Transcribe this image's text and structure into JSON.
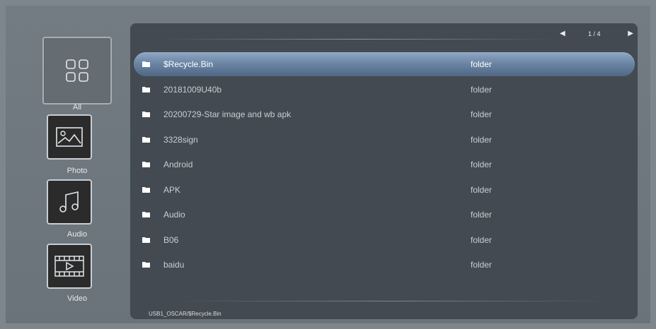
{
  "sidebar": {
    "items": [
      {
        "label": "All",
        "icon": "grid-icon"
      },
      {
        "label": "Photo",
        "icon": "photo-icon"
      },
      {
        "label": "Audio",
        "icon": "music-note-icon"
      },
      {
        "label": "Video",
        "icon": "film-icon"
      }
    ],
    "selected": "All"
  },
  "pager": {
    "prev": "◀",
    "page": "1 / 4",
    "next": "▶"
  },
  "files": [
    {
      "name": "$Recycle.Bin",
      "type": "folder",
      "selected": true
    },
    {
      "name": "20181009U40b",
      "type": "folder"
    },
    {
      "name": "20200729-Star image and wb apk",
      "type": "folder"
    },
    {
      "name": "3328sign",
      "type": "folder"
    },
    {
      "name": "Android",
      "type": "folder"
    },
    {
      "name": "APK",
      "type": "folder"
    },
    {
      "name": "Audio",
      "type": "folder"
    },
    {
      "name": "B06",
      "type": "folder"
    },
    {
      "name": "baidu",
      "type": "folder"
    }
  ],
  "status": {
    "path": "USB1_OSCAR/$Recycle.Bin"
  },
  "colors": {
    "background": "#7d868c",
    "panel": "#434a51",
    "selection": "#6c86a6"
  }
}
